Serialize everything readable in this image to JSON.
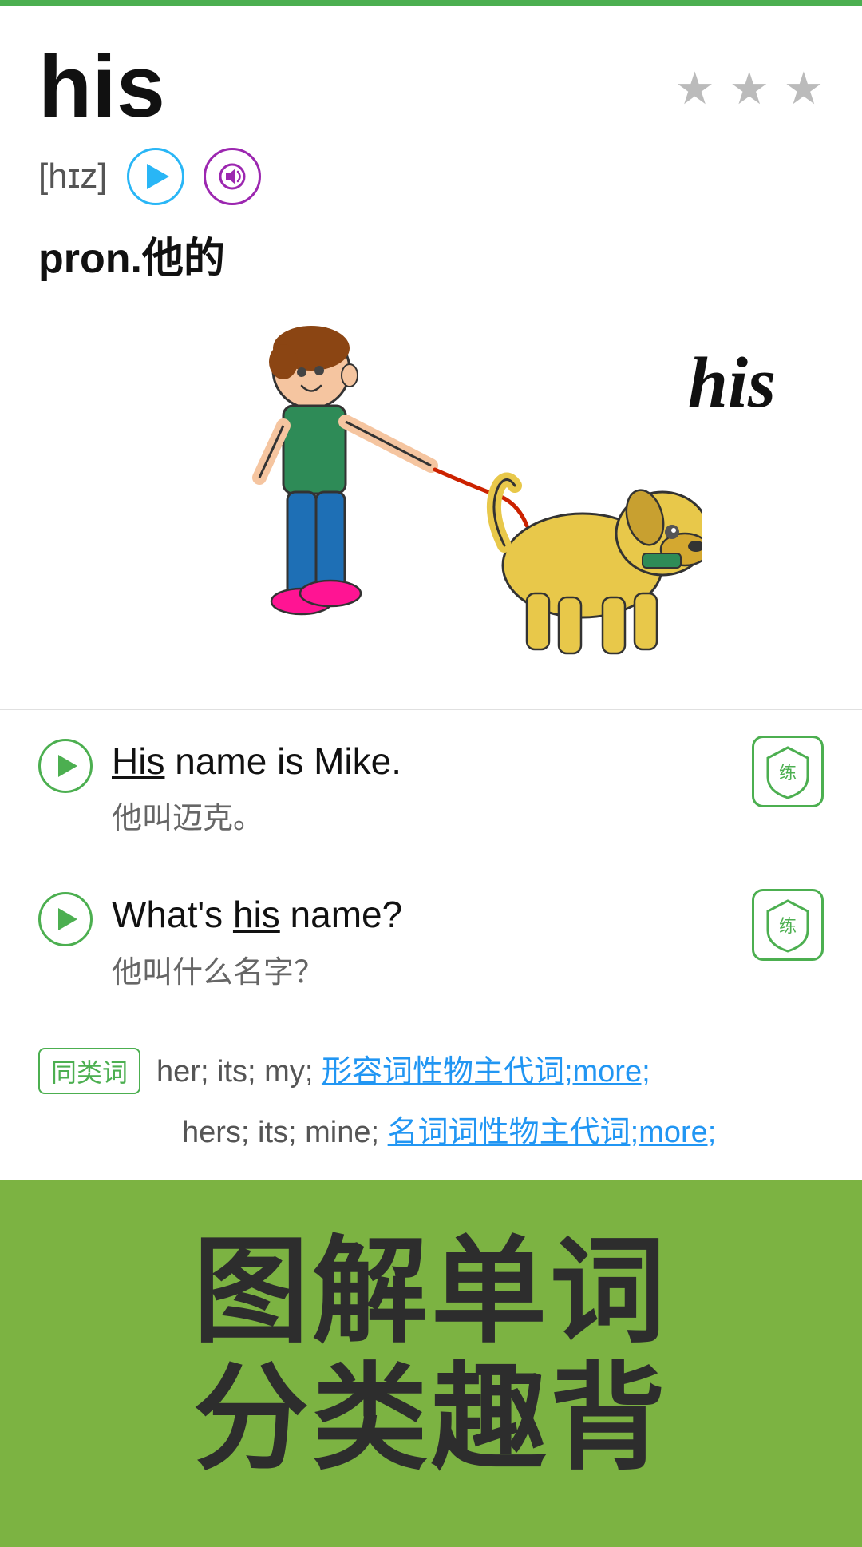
{
  "word": {
    "title": "his",
    "phonetic": "[hɪz]",
    "definition": "pron.他的",
    "word_in_image": "his"
  },
  "stars": {
    "items": [
      "★",
      "★",
      "★"
    ],
    "color": "#bbb"
  },
  "audio": {
    "btn1_label": "audio-us",
    "btn2_label": "audio-uk"
  },
  "examples": [
    {
      "en_before": "",
      "highlight": "His",
      "en_after": " name is Mike.",
      "zh": "他叫迈克。",
      "practice_label": "练"
    },
    {
      "en_before": "What's ",
      "highlight": "his",
      "en_after": " name?",
      "zh": "他叫什么名字？",
      "practice_label": "练"
    }
  ],
  "related": {
    "tag_label": "同类词",
    "row1_plain": "her; its; my; ",
    "row1_link": "形容词性物主代词;more;",
    "row2_plain": "hers; its; mine; ",
    "row2_link": "名词词性物主代词;more;"
  },
  "banner": {
    "line1": "图解单词",
    "line2": "分类趣背"
  }
}
